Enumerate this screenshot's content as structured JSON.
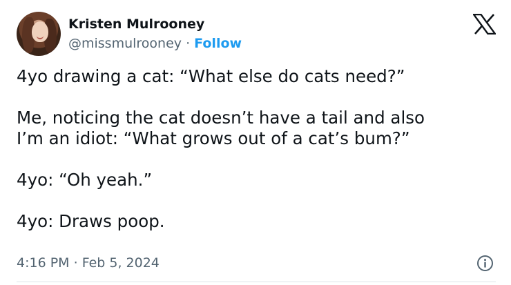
{
  "author": {
    "name": "Kristen Mulrooney",
    "handle": "@missmulrooney",
    "separator": " · ",
    "follow_label": "Follow"
  },
  "tweet": {
    "paragraphs": [
      "4yo drawing a cat: “What else do cats need?”",
      "Me, noticing the cat doesn’t have a tail and also\nI’m an idiot: “What grows out of a cat’s bum?”",
      "4yo: “Oh yeah.”",
      "4yo: Draws poop."
    ],
    "time": "4:16 PM",
    "dot": " · ",
    "date": "Feb 5, 2024"
  },
  "icons": {
    "brand": "x-logo-icon",
    "info": "info-icon"
  },
  "colors": {
    "text": "#0f1419",
    "secondary": "#536471",
    "accent": "#1d9bf0"
  }
}
